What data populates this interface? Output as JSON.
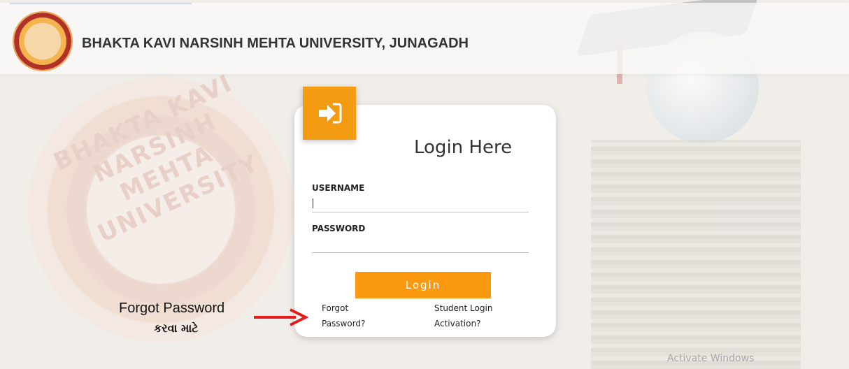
{
  "header": {
    "university_name": "BHAKTA KAVI NARSINH MEHTA UNIVERSITY, JUNAGADH"
  },
  "background": {
    "seal_text": "BHAKTA KAVI NARSINH MEHTA UNIVERSITY"
  },
  "login_card": {
    "title": "Login Here",
    "username_label": "USERNAME",
    "username_value": "",
    "password_label": "PASSWORD",
    "password_value": "",
    "login_button": "Login",
    "forgot_password_line1": "Forgot",
    "forgot_password_line2": "Password?",
    "student_activation_line1": "Student Login",
    "student_activation_line2": "Activation?"
  },
  "annotation": {
    "line1": "Forgot Password",
    "line2": "કરવા માટે",
    "arrow_color": "#e31b1b"
  },
  "watermark": "Activate Windows",
  "colors": {
    "accent": "#fb9a10",
    "badge": "#f39c12"
  },
  "icons": {
    "login_badge": "sign-in-icon"
  }
}
